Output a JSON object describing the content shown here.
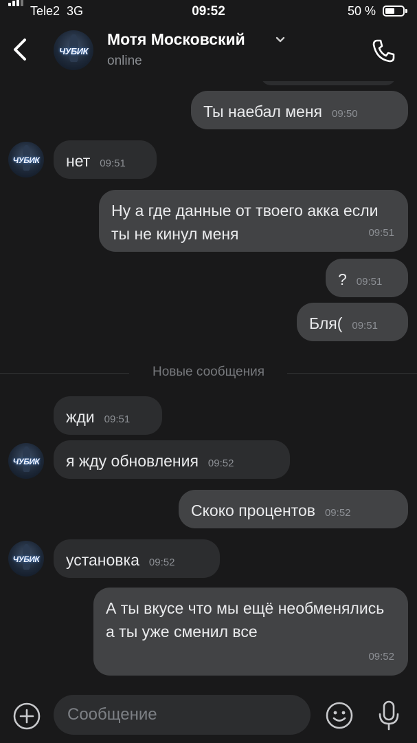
{
  "status_bar": {
    "carrier": "Tele2",
    "network": "3G",
    "time": "09:52",
    "battery": "50 %"
  },
  "header": {
    "avatar_label": "ЧУБИК",
    "name": "Мотя Московский",
    "status": "online"
  },
  "avatar_label": "ЧУБИК",
  "messages": [
    {
      "dir": "out",
      "text": "Ты наебал меня",
      "time": "09:50"
    },
    {
      "dir": "in",
      "text": "нет",
      "time": "09:51"
    },
    {
      "dir": "out",
      "text": "Ну а где данные от твоего акка если ты не кинул меня",
      "time": "09:51"
    },
    {
      "dir": "out",
      "text": "?",
      "time": "09:51"
    },
    {
      "dir": "out",
      "text": "Бля(",
      "time": "09:51"
    },
    {
      "dir": "in",
      "text": "жди",
      "time": "09:51"
    },
    {
      "dir": "in",
      "text": "я жду обновления",
      "time": "09:52"
    },
    {
      "dir": "out",
      "text": "Скоко процентов",
      "time": "09:52"
    },
    {
      "dir": "in",
      "text": "установка",
      "time": "09:52"
    },
    {
      "dir": "out",
      "text": "А ты вкусе что мы ещё необменялись а ты уже сменил все",
      "time": "09:52"
    }
  ],
  "divider_label": "Новые сообщения",
  "composer": {
    "placeholder": "Сообщение"
  },
  "icons": [
    "back-icon",
    "chevron-down-icon",
    "phone-icon",
    "add-icon",
    "emoji-icon",
    "microphone-icon"
  ]
}
